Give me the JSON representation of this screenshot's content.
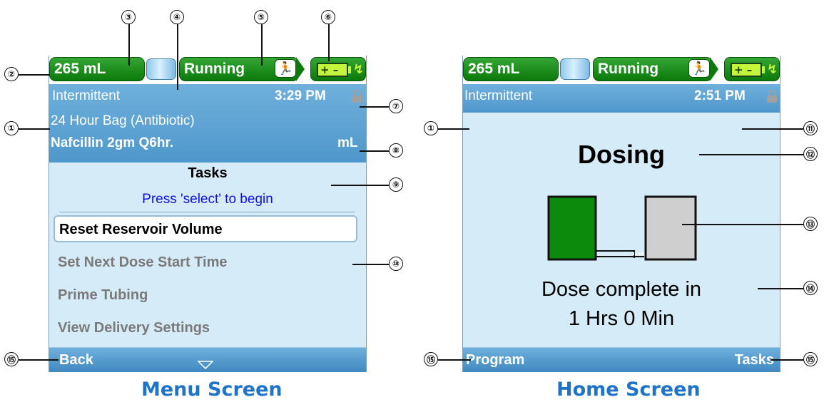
{
  "menu_screen": {
    "caption": "Menu Screen",
    "status": {
      "volume": "265 mL",
      "state": "Running"
    },
    "header": {
      "mode": "Intermittent",
      "time": "3:29 PM",
      "bag": "24 Hour Bag (Antibiotic)",
      "drug": "Nafcillin 2gm Q6hr.",
      "unit": "mL"
    },
    "tasks_title": "Tasks",
    "tasks_hint": "Press 'select' to begin",
    "menu_items": [
      {
        "label": "Reset Reservoir Volume",
        "selected": true
      },
      {
        "label": "Set Next Dose Start Time",
        "selected": false
      },
      {
        "label": "Prime Tubing",
        "selected": false
      },
      {
        "label": "View Delivery Settings",
        "selected": false
      }
    ],
    "footer": {
      "left": "Back"
    }
  },
  "home_screen": {
    "caption": "Home Screen",
    "status": {
      "volume": "265 mL",
      "state": "Running"
    },
    "header": {
      "mode": "Intermittent",
      "time": "2:51 PM"
    },
    "status_title": "Dosing",
    "dose_line1": "Dose complete in",
    "dose_line2": "1 Hrs 0 Min",
    "footer": {
      "left": "Program",
      "right": "Tasks"
    }
  },
  "callouts": [
    "①",
    "②",
    "③",
    "④",
    "⑤",
    "⑥",
    "⑦",
    "⑧",
    "⑨",
    "⑩",
    "⑪",
    "⑫",
    "⑬",
    "⑭",
    "⑮"
  ],
  "colors": {
    "status_green": "#0b7a0b",
    "header_blue": "#5ba3d6",
    "content_bg": "#d6ebf8",
    "caption_blue": "#1f73c8"
  }
}
